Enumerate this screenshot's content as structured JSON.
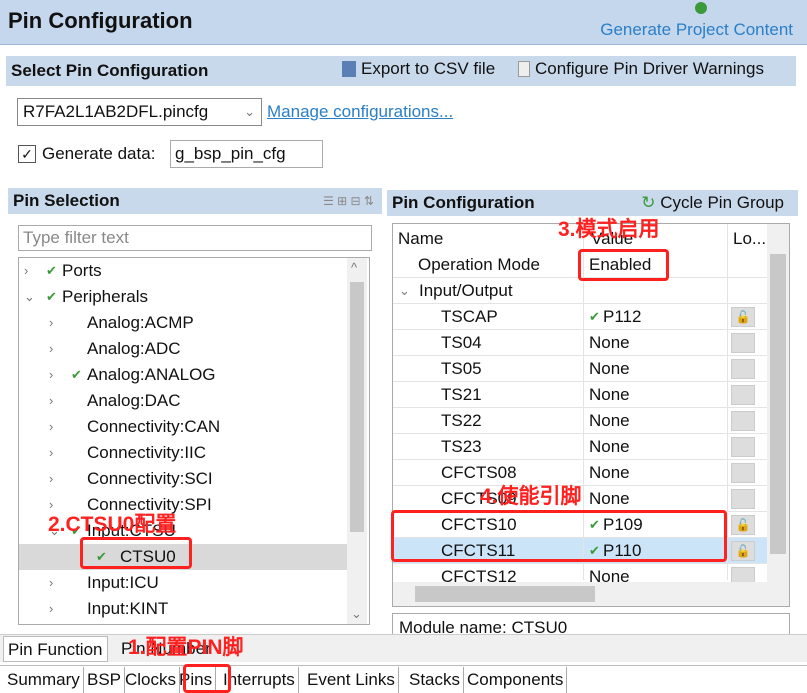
{
  "header": {
    "title": "Pin Configuration",
    "generate": "Generate Project Content"
  },
  "select": {
    "title": "Select Pin Configuration",
    "export": "Export to CSV file",
    "warnings": "Configure Pin Driver Warnings",
    "config_file": "R7FA2L1AB2DFL.pincfg",
    "manage": "Manage configurations...",
    "generate_label": "Generate data:",
    "generate_value": "g_bsp_pin_cfg",
    "generate_checked": true
  },
  "pin_selection": {
    "title": "Pin Selection",
    "filter_placeholder": "Type filter text",
    "items": [
      {
        "label": "Ports",
        "level": 0,
        "check": true,
        "exp": "›"
      },
      {
        "label": "Peripherals",
        "level": 0,
        "check": true,
        "exp": "⌄"
      },
      {
        "label": "Analog:ACMP",
        "level": 1,
        "check": false,
        "exp": "›"
      },
      {
        "label": "Analog:ADC",
        "level": 1,
        "check": false,
        "exp": "›"
      },
      {
        "label": "Analog:ANALOG",
        "level": 1,
        "check": true,
        "exp": "›"
      },
      {
        "label": "Analog:DAC",
        "level": 1,
        "check": false,
        "exp": "›"
      },
      {
        "label": "Connectivity:CAN",
        "level": 1,
        "check": false,
        "exp": "›"
      },
      {
        "label": "Connectivity:IIC",
        "level": 1,
        "check": false,
        "exp": "›"
      },
      {
        "label": "Connectivity:SCI",
        "level": 1,
        "check": false,
        "exp": "›"
      },
      {
        "label": "Connectivity:SPI",
        "level": 1,
        "check": false,
        "exp": "›"
      },
      {
        "label": "Input:CTSU",
        "level": 1,
        "check": true,
        "exp": "⌄"
      },
      {
        "label": "CTSU0",
        "level": 2,
        "check": true,
        "exp": ""
      },
      {
        "label": "Input:ICU",
        "level": 1,
        "check": false,
        "exp": "›"
      },
      {
        "label": "Input:KINT",
        "level": 1,
        "check": false,
        "exp": "›"
      }
    ]
  },
  "pin_config": {
    "title": "Pin Configuration",
    "cycle": "Cycle Pin Group",
    "columns": [
      "Name",
      "Value",
      "Lo..."
    ],
    "rows": [
      {
        "name": "Operation Mode",
        "value": "Enabled",
        "check": false,
        "lock": "none",
        "indent": 1
      },
      {
        "name": "Input/Output",
        "value": "",
        "check": false,
        "lock": "none",
        "indent": 0
      },
      {
        "name": "TSCAP",
        "value": "P112",
        "check": true,
        "lock": "on",
        "indent": 2
      },
      {
        "name": "TS04",
        "value": "None",
        "check": false,
        "lock": "off",
        "indent": 2
      },
      {
        "name": "TS05",
        "value": "None",
        "check": false,
        "lock": "off",
        "indent": 2
      },
      {
        "name": "TS21",
        "value": "None",
        "check": false,
        "lock": "off",
        "indent": 2
      },
      {
        "name": "TS22",
        "value": "None",
        "check": false,
        "lock": "off",
        "indent": 2
      },
      {
        "name": "TS23",
        "value": "None",
        "check": false,
        "lock": "off",
        "indent": 2
      },
      {
        "name": "CFCTS08",
        "value": "None",
        "check": false,
        "lock": "off",
        "indent": 2
      },
      {
        "name": "CFCTS09",
        "value": "None",
        "check": false,
        "lock": "off",
        "indent": 2
      },
      {
        "name": "CFCTS10",
        "value": "P109",
        "check": true,
        "lock": "on",
        "indent": 2
      },
      {
        "name": "CFCTS11",
        "value": "P110",
        "check": true,
        "lock": "on",
        "indent": 2
      },
      {
        "name": "CFCTS12",
        "value": "None",
        "check": false,
        "lock": "off",
        "indent": 2
      }
    ],
    "module_name": "Module name:   CTSU0"
  },
  "view_tabs": [
    "Pin Function",
    "Pin Number"
  ],
  "bottom_tabs": [
    "Summary",
    "BSP",
    "Clocks",
    "Pins",
    "Interrupts",
    "Event Links",
    "Stacks",
    "Components"
  ],
  "annotations": {
    "a1": "1.配置PIN脚",
    "a2": "2.CTSU0配置",
    "a3": "3.模式启用",
    "a4": "4.使能引脚"
  },
  "colors": {
    "accent": "#2a7fc8",
    "annotation": "#ff2020",
    "header_bg": "#c5d7ec"
  }
}
